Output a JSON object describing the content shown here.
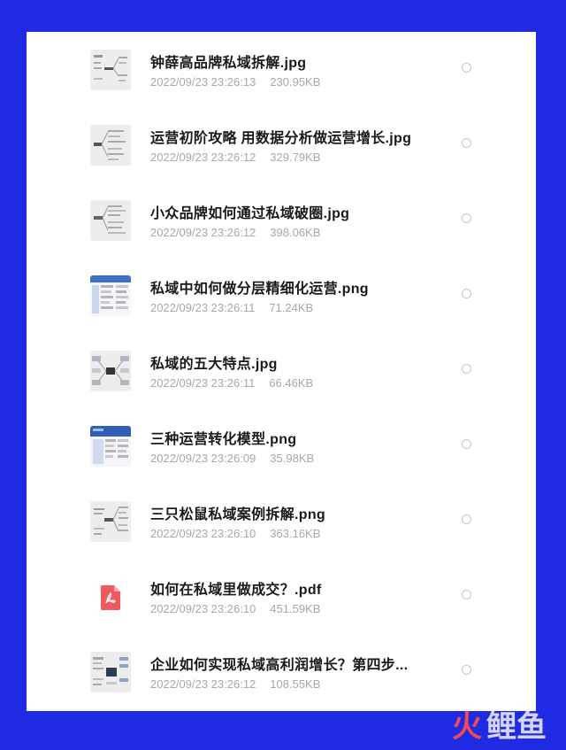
{
  "files": [
    {
      "name": "钟薛高品牌私域拆解.jpg",
      "date": "2022/09/23 23:26:13",
      "size": "230.95KB",
      "thumb_icon": "mindmap-thumbnail-icon"
    },
    {
      "name": "运营初阶攻略 用数据分析做运营增长.jpg",
      "date": "2022/09/23 23:26:12",
      "size": "329.79KB",
      "thumb_icon": "mindmap-thumbnail-icon"
    },
    {
      "name": "小众品牌如何通过私域破圈.jpg",
      "date": "2022/09/23 23:26:12",
      "size": "398.06KB",
      "thumb_icon": "mindmap-thumbnail-icon"
    },
    {
      "name": "私域中如何做分层精细化运营.png",
      "date": "2022/09/23 23:26:11",
      "size": "71.24KB",
      "thumb_icon": "table-thumbnail-icon"
    },
    {
      "name": "私域的五大特点.jpg",
      "date": "2022/09/23 23:26:11",
      "size": "66.46KB",
      "thumb_icon": "diagram-thumbnail-icon"
    },
    {
      "name": "三种运营转化模型.png",
      "date": "2022/09/23 23:26:09",
      "size": "35.98KB",
      "thumb_icon": "table-thumbnail-icon"
    },
    {
      "name": "三只松鼠私域案例拆解.png",
      "date": "2022/09/23 23:26:10",
      "size": "363.16KB",
      "thumb_icon": "mindmap-thumbnail-icon"
    },
    {
      "name": "如何在私域里做成交？.pdf",
      "date": "2022/09/23 23:26:10",
      "size": "451.59KB",
      "thumb_icon": "pdf-icon"
    },
    {
      "name": "企业如何实现私域高利润增长？第四步...",
      "date": "2022/09/23 23:26:12",
      "size": "108.55KB",
      "thumb_icon": "diagram-thumbnail-icon"
    }
  ],
  "watermark": {
    "mark": "火",
    "text": "鲤鱼"
  },
  "colors": {
    "background": "#1f2be3",
    "panel": "#ffffff",
    "pdf_red": "#ee5a5f",
    "watermark_red": "#f04a57"
  }
}
